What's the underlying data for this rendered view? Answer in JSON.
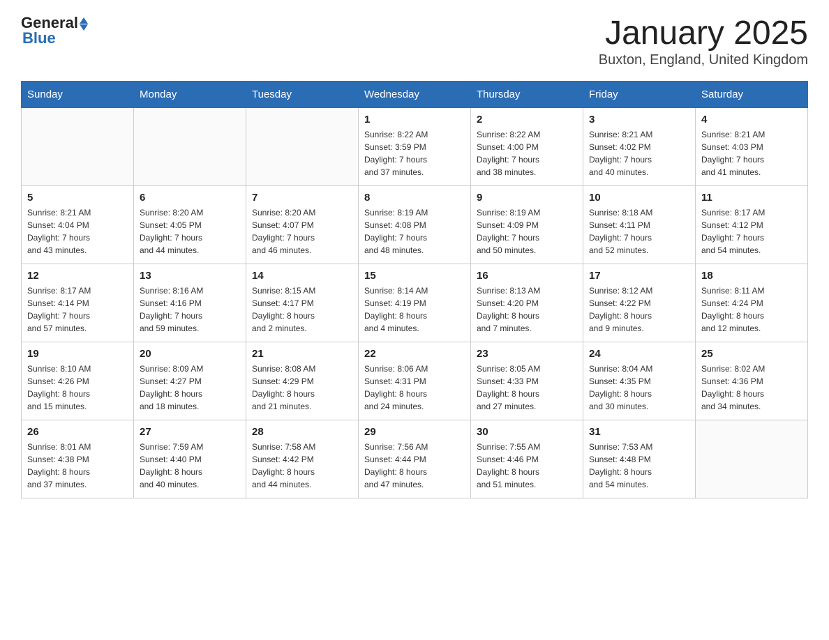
{
  "header": {
    "logo_general": "General",
    "logo_blue": "Blue",
    "month_title": "January 2025",
    "location": "Buxton, England, United Kingdom"
  },
  "weekdays": [
    "Sunday",
    "Monday",
    "Tuesday",
    "Wednesday",
    "Thursday",
    "Friday",
    "Saturday"
  ],
  "weeks": [
    [
      {
        "day": "",
        "info": ""
      },
      {
        "day": "",
        "info": ""
      },
      {
        "day": "",
        "info": ""
      },
      {
        "day": "1",
        "info": "Sunrise: 8:22 AM\nSunset: 3:59 PM\nDaylight: 7 hours\nand 37 minutes."
      },
      {
        "day": "2",
        "info": "Sunrise: 8:22 AM\nSunset: 4:00 PM\nDaylight: 7 hours\nand 38 minutes."
      },
      {
        "day": "3",
        "info": "Sunrise: 8:21 AM\nSunset: 4:02 PM\nDaylight: 7 hours\nand 40 minutes."
      },
      {
        "day": "4",
        "info": "Sunrise: 8:21 AM\nSunset: 4:03 PM\nDaylight: 7 hours\nand 41 minutes."
      }
    ],
    [
      {
        "day": "5",
        "info": "Sunrise: 8:21 AM\nSunset: 4:04 PM\nDaylight: 7 hours\nand 43 minutes."
      },
      {
        "day": "6",
        "info": "Sunrise: 8:20 AM\nSunset: 4:05 PM\nDaylight: 7 hours\nand 44 minutes."
      },
      {
        "day": "7",
        "info": "Sunrise: 8:20 AM\nSunset: 4:07 PM\nDaylight: 7 hours\nand 46 minutes."
      },
      {
        "day": "8",
        "info": "Sunrise: 8:19 AM\nSunset: 4:08 PM\nDaylight: 7 hours\nand 48 minutes."
      },
      {
        "day": "9",
        "info": "Sunrise: 8:19 AM\nSunset: 4:09 PM\nDaylight: 7 hours\nand 50 minutes."
      },
      {
        "day": "10",
        "info": "Sunrise: 8:18 AM\nSunset: 4:11 PM\nDaylight: 7 hours\nand 52 minutes."
      },
      {
        "day": "11",
        "info": "Sunrise: 8:17 AM\nSunset: 4:12 PM\nDaylight: 7 hours\nand 54 minutes."
      }
    ],
    [
      {
        "day": "12",
        "info": "Sunrise: 8:17 AM\nSunset: 4:14 PM\nDaylight: 7 hours\nand 57 minutes."
      },
      {
        "day": "13",
        "info": "Sunrise: 8:16 AM\nSunset: 4:16 PM\nDaylight: 7 hours\nand 59 minutes."
      },
      {
        "day": "14",
        "info": "Sunrise: 8:15 AM\nSunset: 4:17 PM\nDaylight: 8 hours\nand 2 minutes."
      },
      {
        "day": "15",
        "info": "Sunrise: 8:14 AM\nSunset: 4:19 PM\nDaylight: 8 hours\nand 4 minutes."
      },
      {
        "day": "16",
        "info": "Sunrise: 8:13 AM\nSunset: 4:20 PM\nDaylight: 8 hours\nand 7 minutes."
      },
      {
        "day": "17",
        "info": "Sunrise: 8:12 AM\nSunset: 4:22 PM\nDaylight: 8 hours\nand 9 minutes."
      },
      {
        "day": "18",
        "info": "Sunrise: 8:11 AM\nSunset: 4:24 PM\nDaylight: 8 hours\nand 12 minutes."
      }
    ],
    [
      {
        "day": "19",
        "info": "Sunrise: 8:10 AM\nSunset: 4:26 PM\nDaylight: 8 hours\nand 15 minutes."
      },
      {
        "day": "20",
        "info": "Sunrise: 8:09 AM\nSunset: 4:27 PM\nDaylight: 8 hours\nand 18 minutes."
      },
      {
        "day": "21",
        "info": "Sunrise: 8:08 AM\nSunset: 4:29 PM\nDaylight: 8 hours\nand 21 minutes."
      },
      {
        "day": "22",
        "info": "Sunrise: 8:06 AM\nSunset: 4:31 PM\nDaylight: 8 hours\nand 24 minutes."
      },
      {
        "day": "23",
        "info": "Sunrise: 8:05 AM\nSunset: 4:33 PM\nDaylight: 8 hours\nand 27 minutes."
      },
      {
        "day": "24",
        "info": "Sunrise: 8:04 AM\nSunset: 4:35 PM\nDaylight: 8 hours\nand 30 minutes."
      },
      {
        "day": "25",
        "info": "Sunrise: 8:02 AM\nSunset: 4:36 PM\nDaylight: 8 hours\nand 34 minutes."
      }
    ],
    [
      {
        "day": "26",
        "info": "Sunrise: 8:01 AM\nSunset: 4:38 PM\nDaylight: 8 hours\nand 37 minutes."
      },
      {
        "day": "27",
        "info": "Sunrise: 7:59 AM\nSunset: 4:40 PM\nDaylight: 8 hours\nand 40 minutes."
      },
      {
        "day": "28",
        "info": "Sunrise: 7:58 AM\nSunset: 4:42 PM\nDaylight: 8 hours\nand 44 minutes."
      },
      {
        "day": "29",
        "info": "Sunrise: 7:56 AM\nSunset: 4:44 PM\nDaylight: 8 hours\nand 47 minutes."
      },
      {
        "day": "30",
        "info": "Sunrise: 7:55 AM\nSunset: 4:46 PM\nDaylight: 8 hours\nand 51 minutes."
      },
      {
        "day": "31",
        "info": "Sunrise: 7:53 AM\nSunset: 4:48 PM\nDaylight: 8 hours\nand 54 minutes."
      },
      {
        "day": "",
        "info": ""
      }
    ]
  ]
}
